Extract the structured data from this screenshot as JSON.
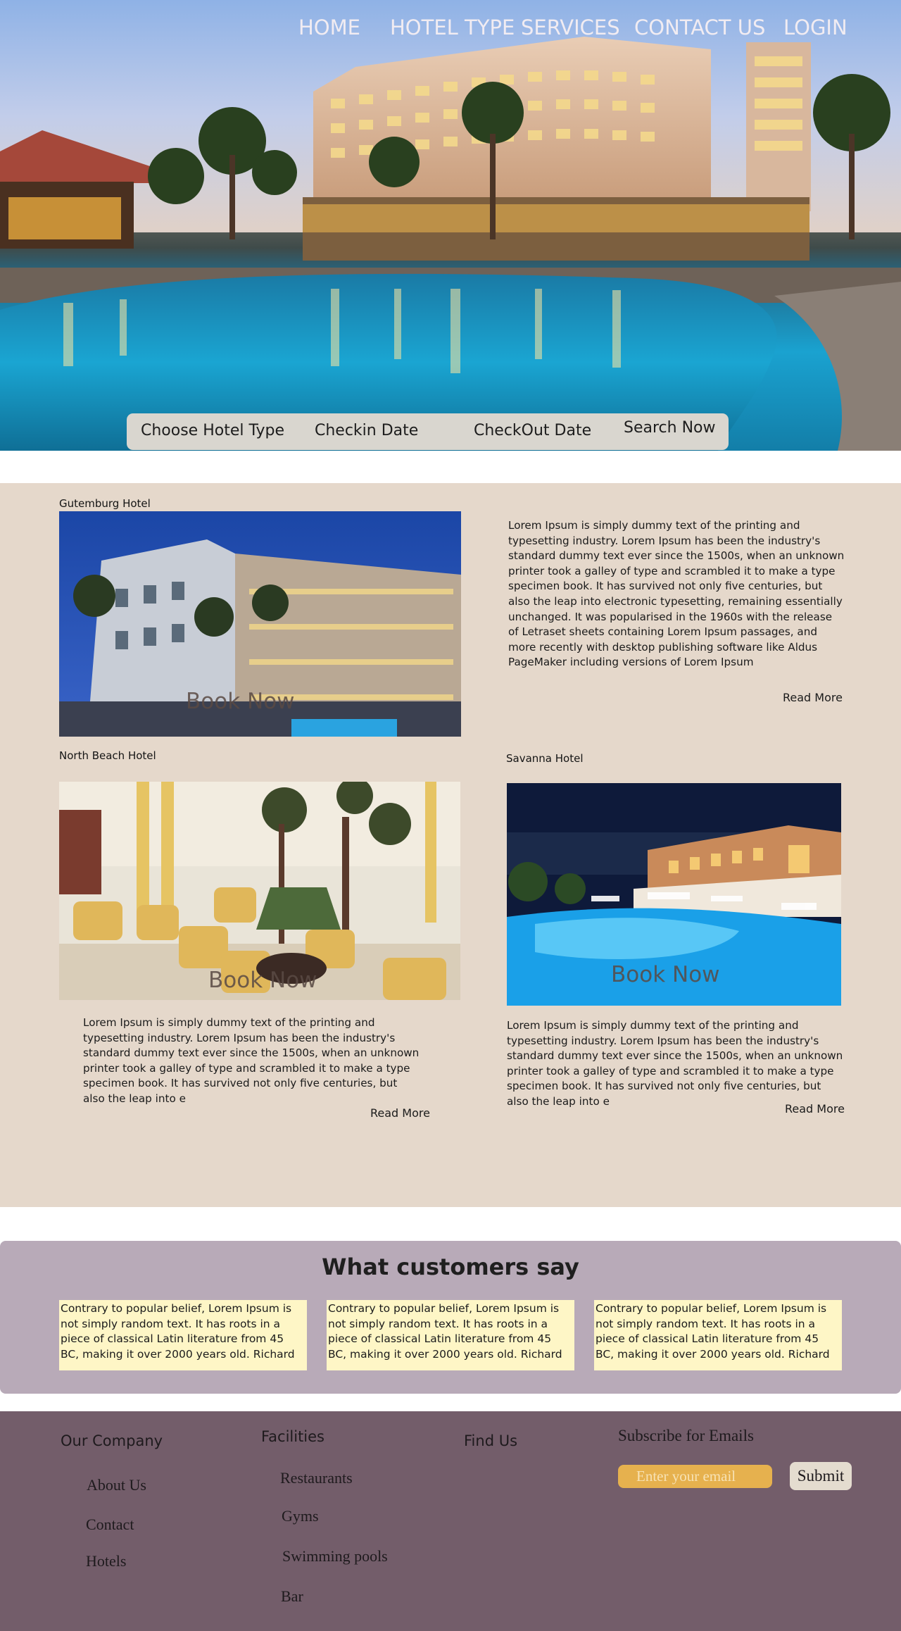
{
  "nav": {
    "home": "HOME",
    "hotel_type": "HOTEL TYPE",
    "services": "SERVICES",
    "contact": "CONTACT US",
    "login": "LOGIN"
  },
  "search": {
    "hotel_type": "Choose Hotel Type",
    "checkin": "Checkin Date",
    "checkout": "CheckOut Date",
    "button": "Search Now"
  },
  "hotels": [
    {
      "name": "Gutemburg Hotel",
      "book_label": "Book Now",
      "description": "Lorem Ipsum is simply dummy text of the printing and typesetting industry. Lorem Ipsum has been the industry's standard dummy text ever since the 1500s, when an unknown printer took a galley of type and scrambled it to make a type specimen book. It has survived not only five centuries, but also the leap into electronic typesetting, remaining essentially unchanged. It was popularised in the 1960s with the release of Letraset sheets containing Lorem Ipsum passages, and more recently with desktop publishing software like Aldus PageMaker including versions of Lorem Ipsum",
      "read_more": "Read More"
    },
    {
      "name": "North Beach Hotel",
      "book_label": "Book Now",
      "description": "Lorem Ipsum is simply dummy text of the printing and typesetting industry. Lorem Ipsum has been the industry's standard dummy text ever since the 1500s, when an unknown printer took a galley of type and scrambled it to make a type specimen book. It has survived not only five centuries, but also the leap into e",
      "read_more": "Read More"
    },
    {
      "name": "Savanna Hotel",
      "book_label": "Book Now",
      "description": "Lorem Ipsum is simply dummy text of the printing and typesetting industry. Lorem Ipsum has been the industry's standard dummy text ever since the 1500s, when an unknown printer took a galley of type and scrambled it to make a type specimen book. It has survived not only five centuries, but also the leap into e",
      "read_more": "Read More"
    }
  ],
  "testimonials": {
    "title": "What customers say",
    "quotes": [
      "Contrary to popular belief, Lorem Ipsum is not simply random text. It has roots in a piece of classical Latin literature from 45 BC, making it over 2000 years old. Richard",
      "Contrary to popular belief, Lorem Ipsum is not simply random text. It has roots in a piece of classical Latin literature from 45 BC, making it over 2000 years old. Richard",
      "Contrary to popular belief, Lorem Ipsum is not simply random text. It has roots in a piece of classical Latin literature from 45 BC, making it over 2000 years old. Richard"
    ]
  },
  "footer": {
    "company": {
      "heading": "Our Company",
      "links": [
        "About Us",
        "Contact",
        "Hotels"
      ]
    },
    "facilities": {
      "heading": "Facilities",
      "links": [
        "Restaurants",
        "Gyms",
        "Swimming pools",
        "Bar"
      ]
    },
    "find_us": {
      "heading": "Find Us"
    },
    "subscribe": {
      "heading": "Subscribe for Emails",
      "placeholder": "Enter your email",
      "button": "Submit"
    }
  },
  "colors": {
    "hotels_bg": "#e5d8cb",
    "testimonials_bg": "#b8aab8",
    "quote_bg": "#fef6c6",
    "footer_bg": "#735d6a",
    "email_input": "#e6b14e",
    "search_bar": "#d9d6cf"
  }
}
